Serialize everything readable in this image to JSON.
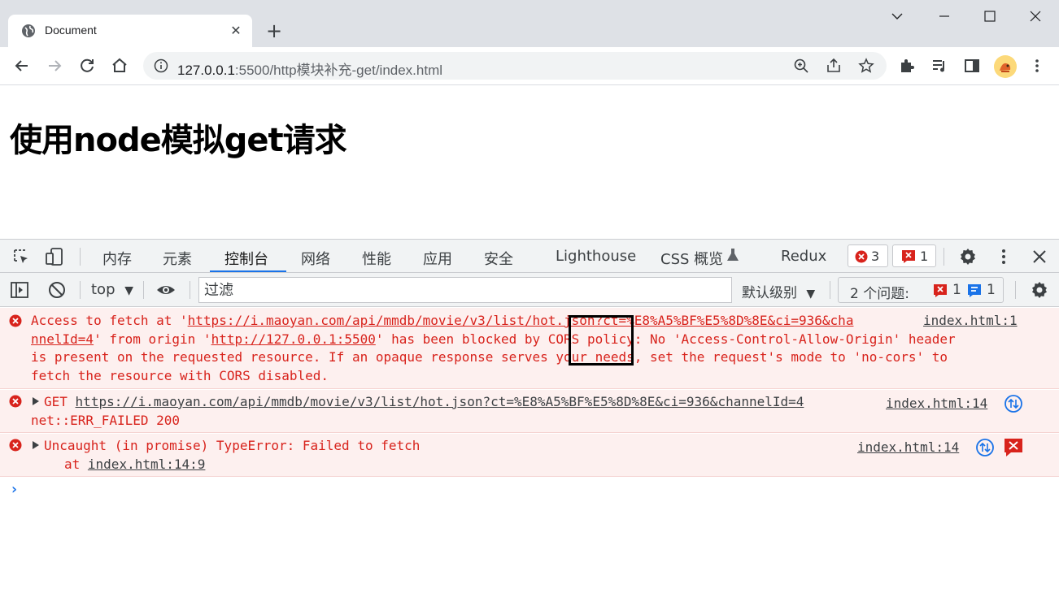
{
  "browser": {
    "tab_title": "Document",
    "tab_close": "✕",
    "new_tab": "+",
    "url_host": "127.0.0.1",
    "url_rest": ":5500/http模块补充-get/index.html"
  },
  "page": {
    "heading": "使用node模拟get请求"
  },
  "devtools": {
    "tabs": [
      "内存",
      "元素",
      "控制台",
      "网络",
      "性能",
      "应用",
      "安全",
      "Lighthouse",
      "CSS 概览",
      "Redux"
    ],
    "active_tab": "控制台",
    "error_count": "3",
    "issue_count": "1",
    "context_select": "top",
    "filter_placeholder": "过滤",
    "levels_label": "默认级别",
    "issues_label": "2 个问题:",
    "issues_error": "1",
    "issues_info": "1"
  },
  "console": {
    "messages": [
      {
        "line1_pre": "Access to fetch at '",
        "line1_url": "https://i.maoyan.com/api/mmdb/movie/v3/list/hot.json?ct=%E8%A5%BF%E5%8D%8E&ci=936&cha",
        "line2_url": "nnelId=4",
        "line2_mid": "' from origin '",
        "line2_origin": "http://127.0.0.1:5500",
        "line2_post": "' has been blocked by CORS policy: No 'Access-Control-Allow-Origin' header",
        "line3": "is present on the requested resource. If an opaque response serves your needs, set the request's mode to 'no-cors' to",
        "line4": "fetch the resource with CORS disabled.",
        "source": "index.html:1"
      },
      {
        "method": "GET",
        "url": "https://i.maoyan.com/api/mmdb/movie/v3/list/hot.json?ct=%E8%A5%BF%E5%8D%8E&ci=936&channelId=4",
        "line2": "net::ERR_FAILED 200",
        "source": "index.html:14"
      },
      {
        "text": "Uncaught (in promise) TypeError: Failed to fetch",
        "at_prefix": "at ",
        "at_link": "index.html:14:9",
        "source": "index.html:14"
      }
    ],
    "prompt": "›"
  },
  "colors": {
    "error_red": "#d8231c",
    "error_bg": "#fdf0ef",
    "accent_blue": "#1a73e8"
  }
}
